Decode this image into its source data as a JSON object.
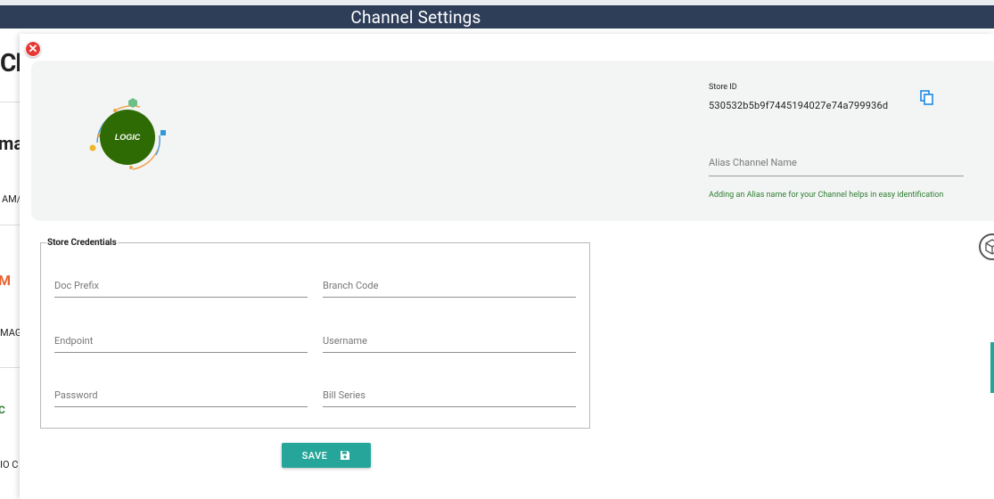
{
  "window": {
    "title": "Channel Settings"
  },
  "background_page": {
    "heading_fragment": "Cl",
    "cards": [
      {
        "logo_fragment": "ma",
        "name_fragment": "AM/"
      },
      {
        "logo_fragment": "M",
        "name_fragment": "MAGI"
      },
      {
        "logo_fragment": "C",
        "name_fragment": "IO C"
      }
    ]
  },
  "modal": {
    "store": {
      "logo_name": "LOGIC",
      "id_label": "Store ID",
      "id_value": "530532b5b9f7445194027e74a799936d",
      "alias_placeholder": "Alias Channel Name",
      "alias_hint": "Adding an Alias name for your Channel helps in easy identification"
    },
    "credentials": {
      "legend": "Store Credentials",
      "fields": {
        "doc_prefix": "Doc Prefix",
        "branch_code": "Branch Code",
        "endpoint": "Endpoint",
        "username": "Username",
        "password": "Password",
        "bill_series": "Bill Series"
      }
    },
    "save_label": "SAVE"
  },
  "colors": {
    "titlebar": "#2e3e59",
    "accent": "#26a69a",
    "close": "#e53935",
    "hint": "#2e7d32",
    "logo_green": "#2f6b05"
  },
  "icons": {
    "close": "close-icon",
    "copy": "copy-icon",
    "save": "floppy-disk-icon",
    "side": "cube-icon"
  }
}
